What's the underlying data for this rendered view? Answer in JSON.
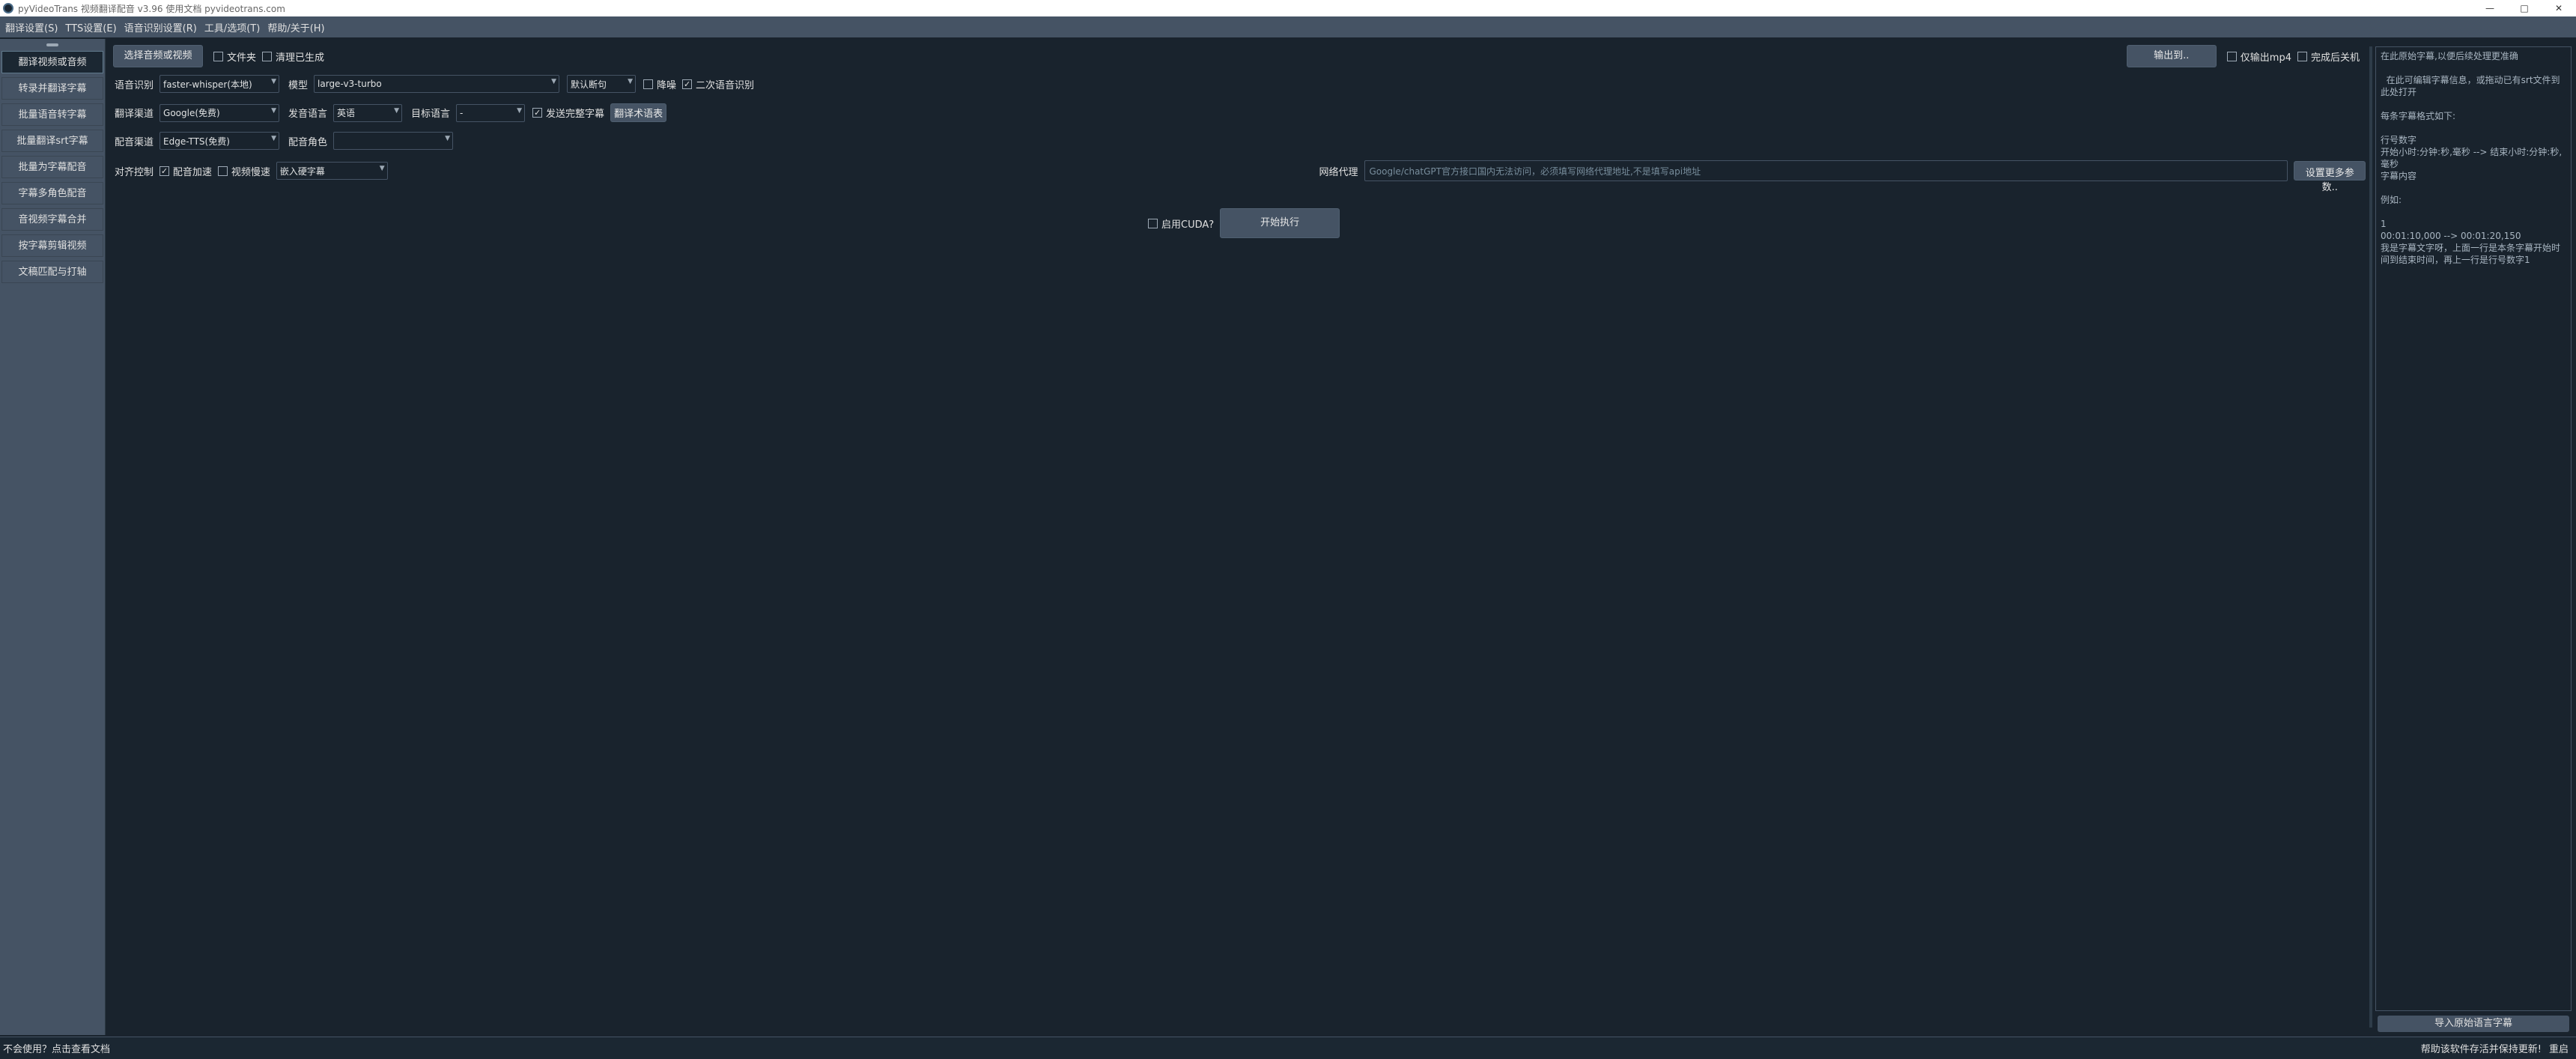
{
  "window": {
    "title": "pyVideoTrans 视频翻译配音 v3.96 使用文档 pyvideotrans.com",
    "minimize": "—",
    "maximize": "□",
    "close": "✕"
  },
  "menu": [
    "翻译设置(S)",
    "TTS设置(E)",
    "语音识别设置(R)",
    "工具/选项(T)",
    "帮助/关于(H)"
  ],
  "sidebar": {
    "items": [
      "翻译视频或音频",
      "转录并翻译字幕",
      "批量语音转字幕",
      "批量翻译srt字幕",
      "批量为字幕配音",
      "字幕多角色配音",
      "音视频字幕合并",
      "按字幕剪辑视频",
      "文稿匹配与打轴"
    ]
  },
  "top": {
    "select_media": "选择音频或视频",
    "folder": "文件夹",
    "clear_generated": "清理已生成",
    "output_to": "输出到..",
    "only_mp4": "仅输出mp4",
    "shutdown": "完成后关机"
  },
  "asr": {
    "label": "语音识别",
    "value": "faster-whisper(本地)",
    "model_label": "模型",
    "model_value": "large-v3-turbo",
    "split_value": "默认断句",
    "denoise": "降噪",
    "second_asr": "二次语音识别"
  },
  "translate": {
    "label": "翻译渠道",
    "value": "Google(免费)",
    "src_label": "发音语言",
    "src_value": "英语",
    "tgt_label": "目标语言",
    "tgt_value": "-",
    "send_full": "发送完整字幕",
    "terms_btn": "翻译术语表"
  },
  "tts": {
    "label": "配音渠道",
    "value": "Edge-TTS(免费)",
    "role_label": "配音角色",
    "role_value": ""
  },
  "align": {
    "label": "对齐控制",
    "speedup": "配音加速",
    "slow_video": "视频慢速",
    "subtitle_value": "嵌入硬字幕"
  },
  "proxy": {
    "label": "网络代理",
    "placeholder": "Google/chatGPT官方接口国内无法访问，必须填写网络代理地址,不是填写api地址",
    "more_btn": "设置更多参数.."
  },
  "run": {
    "cuda": "启用CUDA?",
    "start": "开始执行"
  },
  "subtitle_panel": {
    "lines": [
      "在此原始字幕,以便后续处理更准确",
      "",
      "  在此可编辑字幕信息，或拖动已有srt文件到此处打开",
      "",
      "每条字幕格式如下:",
      "",
      "行号数字",
      "开始小时:分钟:秒,毫秒 --> 结束小时:分钟:秒,毫秒",
      "字幕内容",
      "",
      "例如:",
      "",
      "1",
      "00:01:10,000 --> 00:01:20,150",
      "我是字幕文字呀，上面一行是本条字幕开始时间到结束时间，再上一行是行号数字1"
    ],
    "import_btn": "导入原始语言字幕"
  },
  "status": {
    "left": "不会使用？点击查看文档",
    "right": "帮助该软件存活并保持更新!",
    "redo": "重启"
  },
  "colors": {
    "background": "#19232d",
    "panel": "#455364"
  }
}
